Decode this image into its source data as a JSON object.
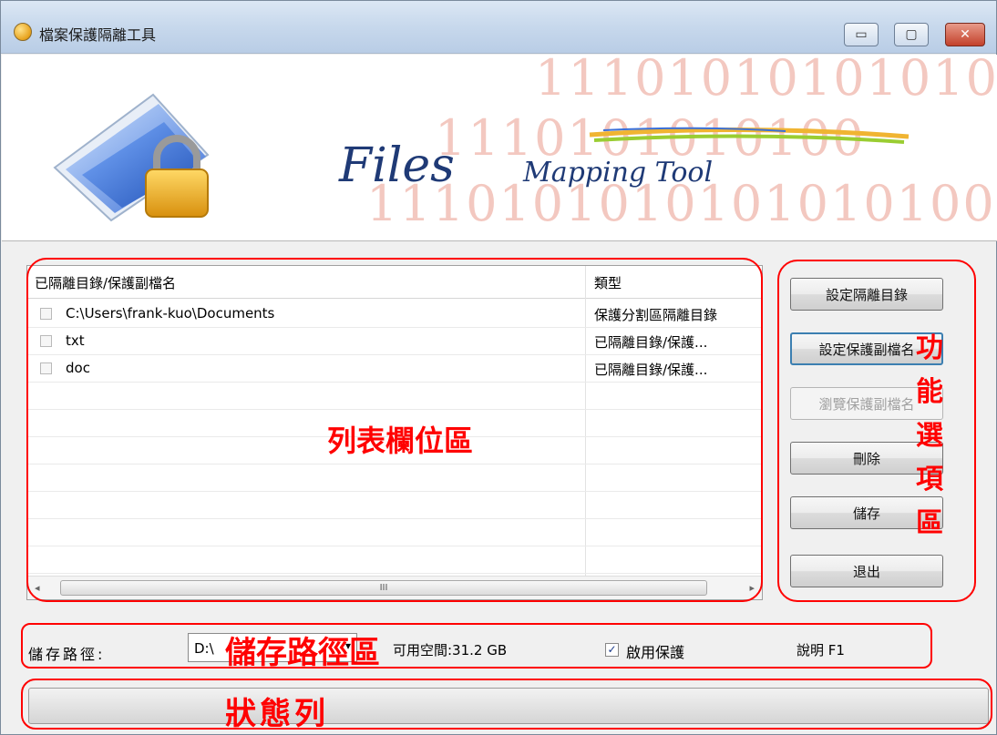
{
  "window": {
    "title": "檔案保護隔離工具",
    "minimize_glyph": "▭",
    "maximize_glyph": "▢",
    "close_glyph": "✕"
  },
  "banner": {
    "brand_main": "Files",
    "brand_sub": "Mapping Tool",
    "binary_lines": [
      "1110101010101010",
      "1110101010100",
      "1110101010101010100"
    ]
  },
  "list": {
    "headers": [
      "已隔離目錄/保護副檔名",
      "類型"
    ],
    "rows": [
      {
        "name": "C:\\Users\\frank-kuo\\Documents",
        "type": "保護分割區隔離目錄"
      },
      {
        "name": "txt",
        "type": "已隔離目錄/保護..."
      },
      {
        "name": "doc",
        "type": "已隔離目錄/保護..."
      }
    ],
    "scroll_left": "◂",
    "scroll_right": "▸",
    "scroll_grip": "III"
  },
  "buttons": {
    "set_isolation_dir": "設定隔離目錄",
    "set_protect_ext": "設定保護副檔名",
    "browse_protect_ext": "瀏覽保護副檔名",
    "delete": "刪除",
    "save": "儲存",
    "exit": "退出"
  },
  "storage": {
    "path_label": "儲存路徑:",
    "path_value": "D:\\",
    "dropdown_arrow": "▾",
    "free_space": "可用空間:31.2 GB",
    "enable_protection_label": "啟用保護",
    "enable_protection_checked": true,
    "check_glyph": "✓",
    "help": "說明 F1"
  },
  "annotations": {
    "list_area": "列表欄位區",
    "function_area": [
      "功",
      "能",
      "選",
      "項",
      "區"
    ],
    "storage_area": "儲存路徑區",
    "status_bar": "狀態列",
    "color": "#ff0000"
  },
  "icons": [
    "app-icon",
    "folder-lock-icon",
    "minimize-icon",
    "maximize-icon",
    "close-icon"
  ]
}
